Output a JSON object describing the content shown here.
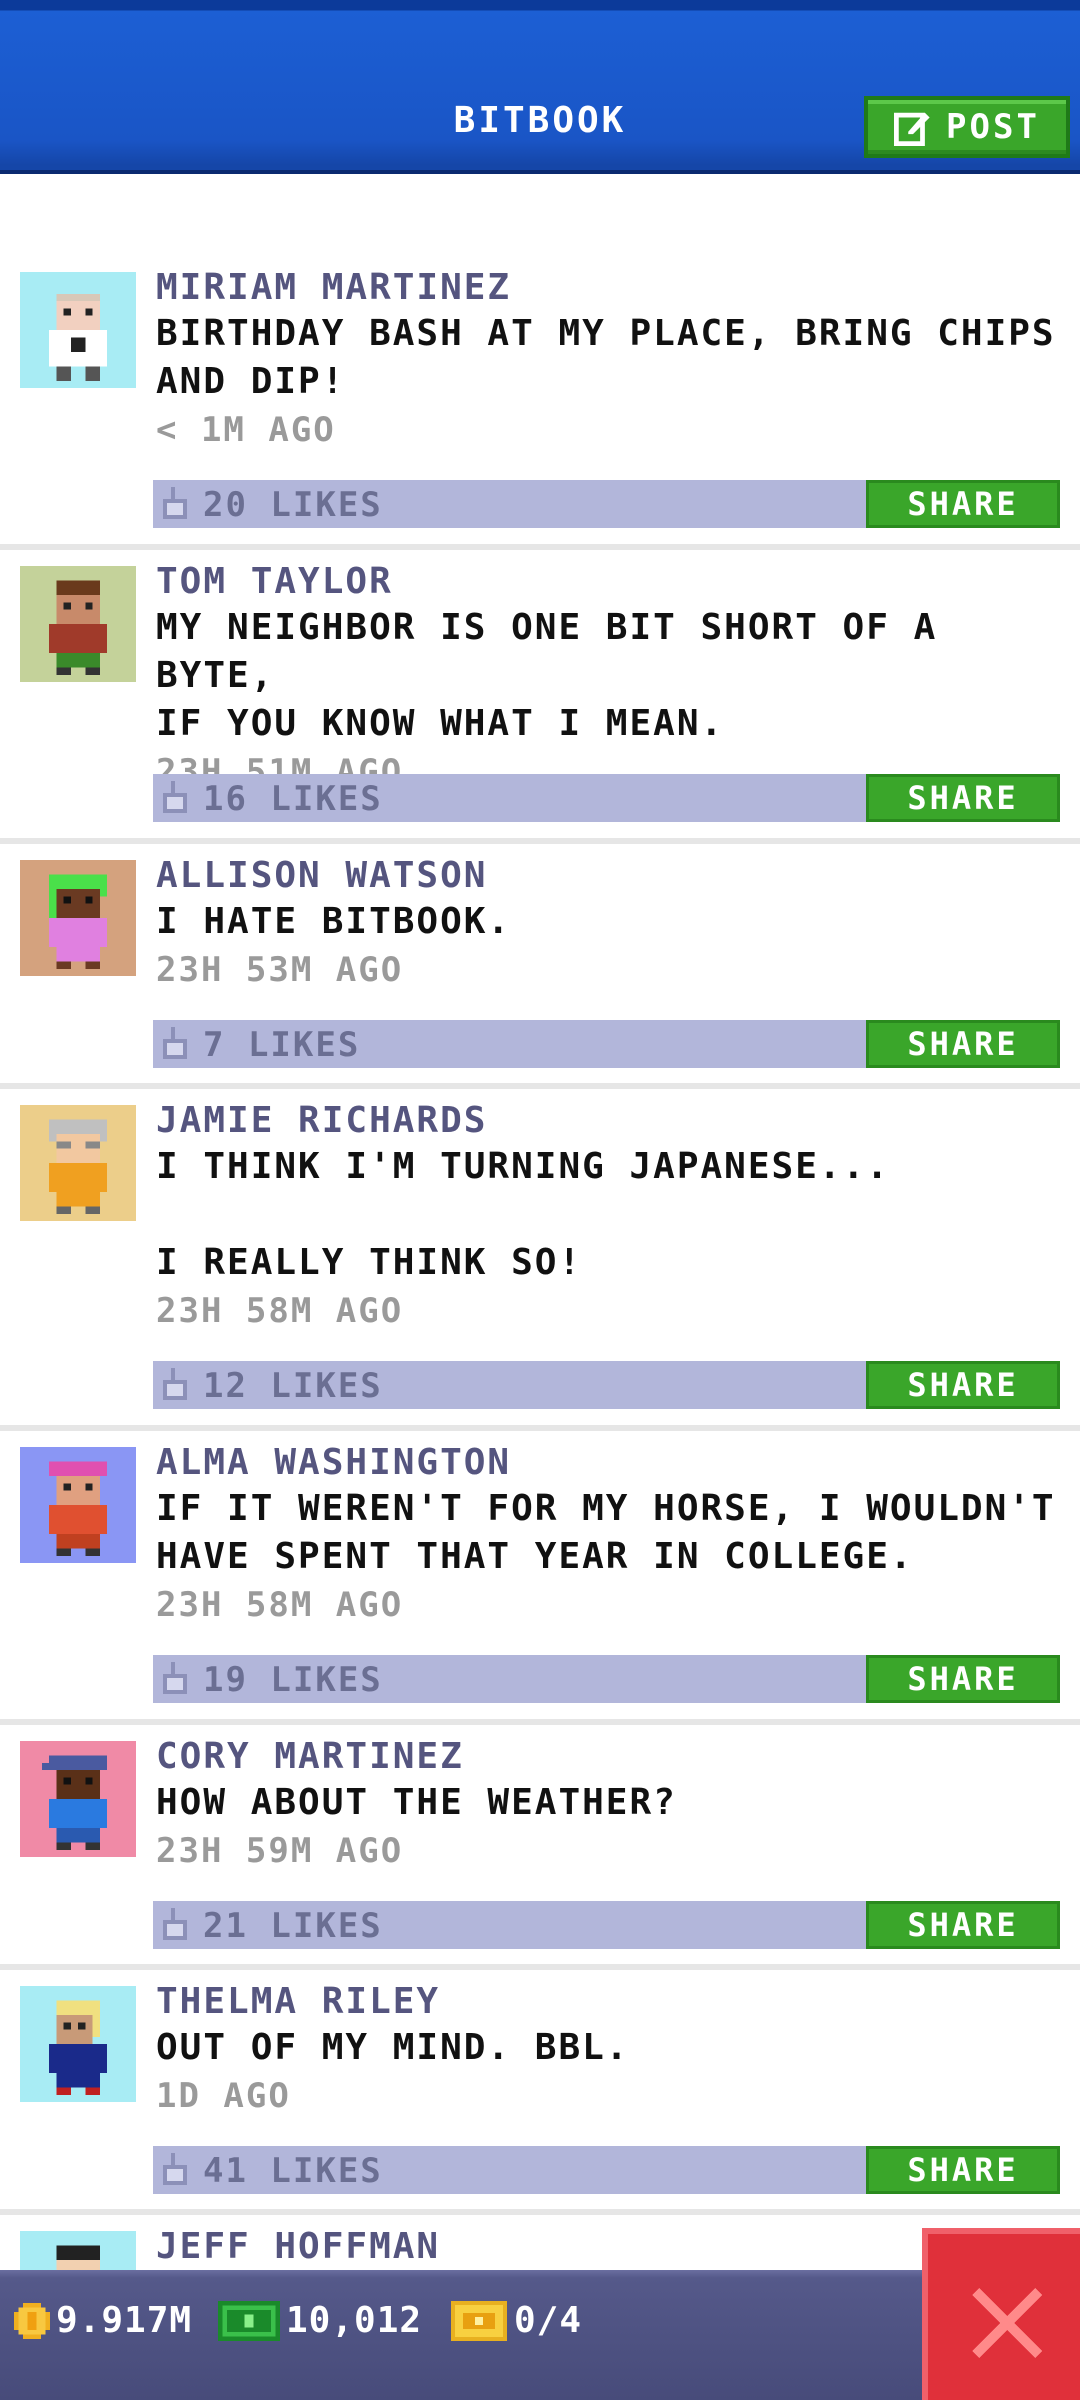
{
  "header": {
    "title": "BITBOOK",
    "post_label": "POST"
  },
  "posts": [
    {
      "author": "MIRIAM MARTINEZ",
      "text": "BIRTHDAY BASH AT MY PLACE, BRING CHIPS\nAND DIP!",
      "time": "< 1M AGO",
      "likes": "20 LIKES",
      "share": "SHARE",
      "avatar_bg": "#a8ecf4"
    },
    {
      "author": "TOM TAYLOR",
      "text": "MY NEIGHBOR IS ONE BIT SHORT OF A BYTE,\nIF YOU KNOW WHAT I MEAN.",
      "time": "23H 51M AGO",
      "likes": "16 LIKES",
      "share": "SHARE",
      "avatar_bg": "#c4d29a"
    },
    {
      "author": "ALLISON WATSON",
      "text": "I HATE BITBOOK.",
      "time": "23H 53M AGO",
      "likes": "7 LIKES",
      "share": "SHARE",
      "avatar_bg": "#d4a27e"
    },
    {
      "author": "JAMIE RICHARDS",
      "text": "I THINK I'M TURNING JAPANESE...\n\nI REALLY THINK SO!",
      "time": "23H 58M AGO",
      "likes": "12 LIKES",
      "share": "SHARE",
      "avatar_bg": "#ecce8a"
    },
    {
      "author": "ALMA WASHINGTON",
      "text": "IF IT WEREN'T FOR MY HORSE, I WOULDN'T\nHAVE SPENT THAT YEAR IN COLLEGE.",
      "time": "23H 58M AGO",
      "likes": "19 LIKES",
      "share": "SHARE",
      "avatar_bg": "#8a96f4"
    },
    {
      "author": "CORY MARTINEZ",
      "text": "HOW ABOUT THE WEATHER?",
      "time": "23H 59M AGO",
      "likes": "21 LIKES",
      "share": "SHARE",
      "avatar_bg": "#f08aa6"
    },
    {
      "author": "THELMA RILEY",
      "text": "OUT OF MY MIND. BBL.",
      "time": "1D AGO",
      "likes": "41 LIKES",
      "share": "SHARE",
      "avatar_bg": "#a8ecf4"
    },
    {
      "author": "JEFF HOFFMAN",
      "text": "",
      "time": "",
      "likes": "",
      "share": "",
      "avatar_bg": "#a8ecf4"
    }
  ],
  "bottom": {
    "coins": "9.917M",
    "bux": "10,012",
    "tickets": "0/4"
  },
  "colors": {
    "header": "#1a55c6",
    "accent_green": "#3aa62a",
    "like_bar": "#b2b6da",
    "close_red": "#e0303a"
  }
}
